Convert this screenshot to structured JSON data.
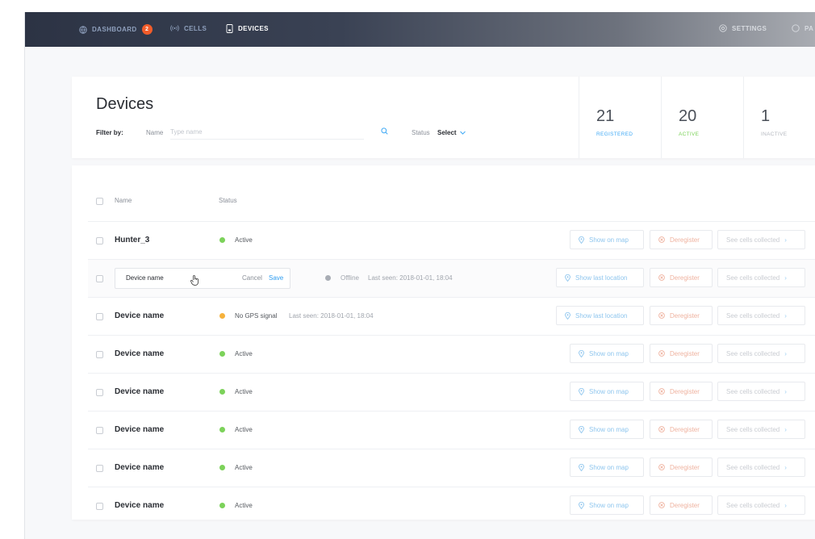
{
  "nav": {
    "dashboard": "DASHBOARD",
    "dashboard_badge": "2",
    "cells": "CELLS",
    "devices": "DEVICES",
    "settings": "SETTINGS",
    "pa": "PA"
  },
  "header": {
    "title": "Devices",
    "filter_label": "Filter by:",
    "name_label": "Name",
    "name_placeholder": "Type name",
    "status_label": "Status",
    "status_value": "Select"
  },
  "stats": [
    {
      "value": "21",
      "label": "REGISTERED"
    },
    {
      "value": "20",
      "label": "ACTIVE"
    },
    {
      "value": "1",
      "label": "INACTIVE"
    }
  ],
  "table": {
    "col_name": "Name",
    "col_status": "Status",
    "rows": [
      {
        "name": "Hunter_3",
        "status": "Active",
        "location": "Show on map",
        "deregister": "Deregister",
        "cells": "See cells collected"
      },
      {
        "name": "Device name",
        "status": "Offline",
        "last_seen": "Last seen: 2018-01-01, 18:04",
        "location": "Show last location",
        "deregister": "Deregister",
        "cells": "See cells collected",
        "cancel": "Cancel",
        "save": "Save"
      },
      {
        "name": "Device name",
        "status": "No GPS signal",
        "last_seen": "Last seen: 2018-01-01, 18:04",
        "location": "Show last location",
        "deregister": "Deregister",
        "cells": "See cells collected"
      },
      {
        "name": "Device name",
        "status": "Active",
        "location": "Show on map",
        "deregister": "Deregister",
        "cells": "See cells collected"
      },
      {
        "name": "Device name",
        "status": "Active",
        "location": "Show on map",
        "deregister": "Deregister",
        "cells": "See cells collected"
      },
      {
        "name": "Device name",
        "status": "Active",
        "location": "Show on map",
        "deregister": "Deregister",
        "cells": "See cells collected"
      },
      {
        "name": "Device name",
        "status": "Active",
        "location": "Show on map",
        "deregister": "Deregister",
        "cells": "See cells collected"
      },
      {
        "name": "Device name",
        "status": "Active",
        "location": "Show on map",
        "deregister": "Deregister",
        "cells": "See cells collected"
      }
    ]
  },
  "colors": {
    "nav_dark": "#2c3344",
    "accent_blue": "#3fa9f5",
    "active_green": "#7cd25a",
    "warning_amber": "#f6b23c",
    "offline_grey": "#a9adb5",
    "badge_orange": "#f25c2a"
  },
  "icons": {
    "dashboard": "globe-icon",
    "cells": "signal-icon",
    "devices": "phone-icon",
    "settings": "gear-icon",
    "search": "search-icon",
    "location": "map-pin-icon",
    "deregister": "remove-circle-icon",
    "cells_link": "chevron-right-icon"
  }
}
